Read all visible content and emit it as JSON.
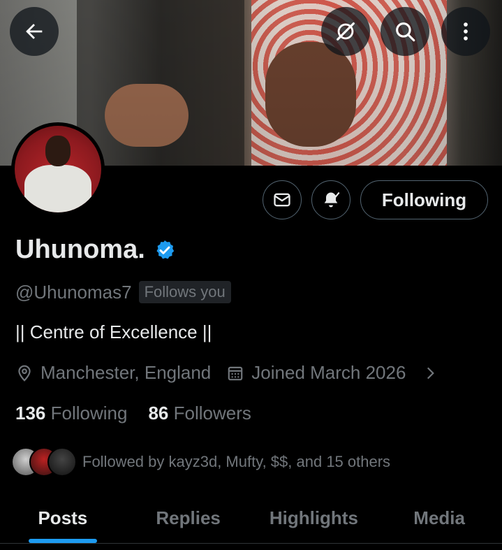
{
  "profile": {
    "name": "Uhunoma.",
    "handle": "@Uhunomas7",
    "follows_you_label": "Follows you",
    "bio": "|| Centre of Excellence ||",
    "location": "Manchester, England",
    "joined": "Joined March 2026",
    "following_count": "136",
    "following_label": "Following",
    "followers_count": "86",
    "followers_label": "Followers",
    "followed_by": "Followed by kayz3d, Mufty, $$, and 15 others"
  },
  "header": {
    "follow_button_label": "Following",
    "icons": [
      "back-arrow-icon",
      "grok-icon",
      "search-icon",
      "more-vertical-icon",
      "mail-icon",
      "notification-bell-icon"
    ]
  },
  "tabs": [
    {
      "label": "Posts",
      "active": true
    },
    {
      "label": "Replies",
      "active": false
    },
    {
      "label": "Highlights",
      "active": false
    },
    {
      "label": "Media",
      "active": false
    }
  ],
  "colors": {
    "accent": "#1d9bf0",
    "background": "#000000",
    "text_primary": "#e7e9ea",
    "text_secondary": "#71767b",
    "border": "#536471"
  }
}
